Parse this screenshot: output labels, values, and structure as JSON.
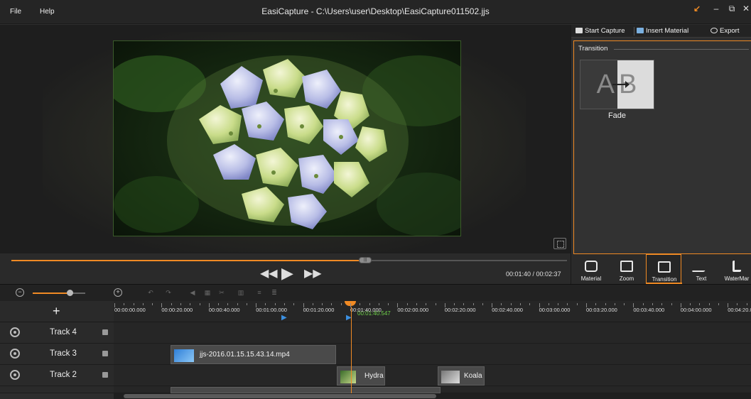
{
  "menu": {
    "file": "File",
    "help": "Help"
  },
  "title": "EasiCapture - C:\\Users\\user\\Desktop\\EasiCapture011502.jjs",
  "player": {
    "time": "00:01:40 / 00:02:37",
    "progress": 0.637
  },
  "right_toolbar": {
    "start_capture": "Start Capture",
    "insert_material": "Insert Material",
    "export": "Export"
  },
  "transition_panel": {
    "section": "Transition",
    "fade_label": "Fade",
    "fade_a": "A",
    "fade_b": "B"
  },
  "tabs": [
    {
      "label": "Material",
      "icon": "camera-icon"
    },
    {
      "label": "Zoom",
      "icon": "zoom-icon"
    },
    {
      "label": "Transition",
      "icon": "transition-icon",
      "active": true
    },
    {
      "label": "Text",
      "icon": "pen-icon"
    },
    {
      "label": "WaterMar",
      "icon": "watermark-icon"
    }
  ],
  "timeline": {
    "zoom_level": 0.7,
    "ticks": [
      "00:00:00.000",
      "00:00:20.000",
      "00:00:40.000",
      "00:01:00.000",
      "00:01:20.000",
      "00:01:40.000",
      "00:02:00.000",
      "00:02:20.000",
      "00:02:40.000",
      "00:03:00.000",
      "00:03:20.000",
      "00:03:40.000",
      "00:04:00.000",
      "00:04:20.0"
    ],
    "playhead_time": "00:01:40.547",
    "tracks": [
      {
        "name": "Track 4"
      },
      {
        "name": "Track 3"
      },
      {
        "name": "Track 2"
      }
    ],
    "clips": {
      "track3": "jjs-2016.01.15.15.43.14.mp4",
      "hydra": "Hydra",
      "koala": "Koala"
    }
  },
  "colors": {
    "accent": "#f08a24",
    "playhead_time": "#6fd14a",
    "marker": "#3b8fe0"
  }
}
